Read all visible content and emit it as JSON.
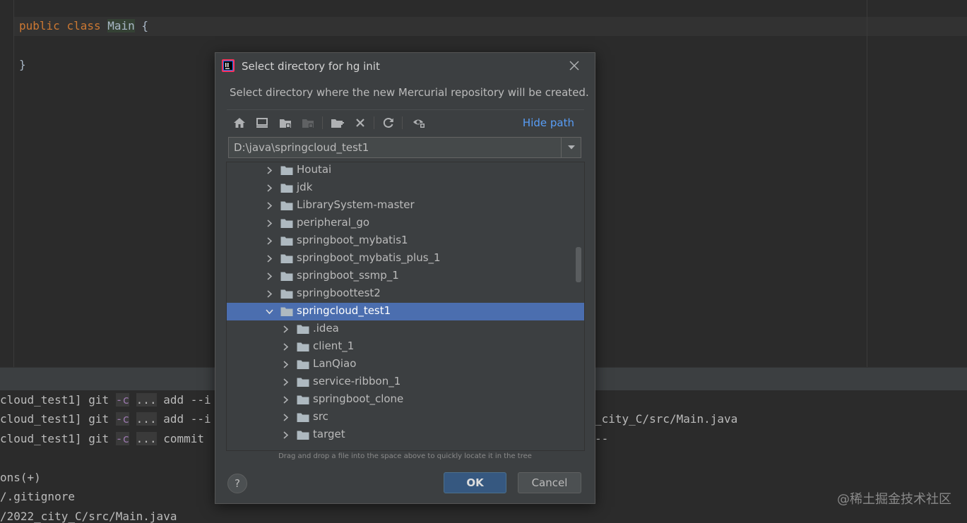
{
  "editor": {
    "line1": {
      "kw1": "public",
      "kw2": "class",
      "name": "Main",
      "brace": "{"
    },
    "line2": "}"
  },
  "console": {
    "lines": [
      {
        "prefix": "cloud_test1] git",
        "flag": "-c",
        "dots": "...",
        "cmd": "add --i",
        "right": ""
      },
      {
        "prefix": "cloud_test1] git",
        "flag": "-c",
        "dots": "...",
        "cmd": "add --i",
        "right": "_city_C/src/Main.java"
      },
      {
        "prefix": "cloud_test1] git",
        "flag": "-c",
        "dots": "...",
        "cmd": "commit",
        "right": "--"
      }
    ],
    "extra": [
      "ons(+)",
      "/.gitignore",
      "/2022_city_C/src/Main.java"
    ]
  },
  "watermark": "@稀土掘金技术社区",
  "dialog": {
    "title": "Select directory for hg init",
    "description": "Select directory where the new Mercurial repository will be created.",
    "hide_path": "Hide path",
    "path": "D:\\java\\springcloud_test1",
    "tree": [
      {
        "label": "Houtai",
        "depth": 0,
        "expanded": false,
        "selected": false
      },
      {
        "label": "jdk",
        "depth": 0,
        "expanded": false,
        "selected": false
      },
      {
        "label": "LibrarySystem-master",
        "depth": 0,
        "expanded": false,
        "selected": false
      },
      {
        "label": "peripheral_go",
        "depth": 0,
        "expanded": false,
        "selected": false
      },
      {
        "label": "springboot_mybatis1",
        "depth": 0,
        "expanded": false,
        "selected": false
      },
      {
        "label": "springboot_mybatis_plus_1",
        "depth": 0,
        "expanded": false,
        "selected": false
      },
      {
        "label": "springboot_ssmp_1",
        "depth": 0,
        "expanded": false,
        "selected": false
      },
      {
        "label": "springboottest2",
        "depth": 0,
        "expanded": false,
        "selected": false
      },
      {
        "label": "springcloud_test1",
        "depth": 0,
        "expanded": true,
        "selected": true
      },
      {
        "label": ".idea",
        "depth": 1,
        "expanded": false,
        "selected": false
      },
      {
        "label": "client_1",
        "depth": 1,
        "expanded": false,
        "selected": false
      },
      {
        "label": "LanQiao",
        "depth": 1,
        "expanded": false,
        "selected": false
      },
      {
        "label": "service-ribbon_1",
        "depth": 1,
        "expanded": false,
        "selected": false
      },
      {
        "label": "springboot_clone",
        "depth": 1,
        "expanded": false,
        "selected": false
      },
      {
        "label": "src",
        "depth": 1,
        "expanded": false,
        "selected": false
      },
      {
        "label": "target",
        "depth": 1,
        "expanded": false,
        "selected": false
      }
    ],
    "hint": "Drag and drop a file into the space above to quickly locate it in the tree",
    "help_label": "?",
    "ok_label": "OK",
    "cancel_label": "Cancel"
  },
  "colors": {
    "accent": "#589df6",
    "selection": "#4b6eaf",
    "ok_button": "#365880"
  }
}
